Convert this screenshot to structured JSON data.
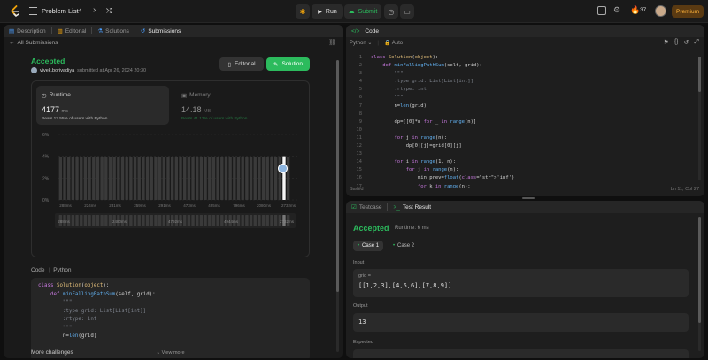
{
  "topbar": {
    "problem_list": "Problem List",
    "run": "Run",
    "submit": "Submit",
    "streak": "37",
    "premium": "Premium"
  },
  "left": {
    "tabs": [
      {
        "label": "Description"
      },
      {
        "label": "Editorial"
      },
      {
        "label": "Solutions"
      },
      {
        "label": "Submissions"
      }
    ],
    "back": "All Submissions",
    "status": "Accepted",
    "user": "vivek.borivadiya",
    "submitted": "submitted at Apr 26, 2024 20:30",
    "editorial_btn": "Editorial",
    "solution_btn": "Solution",
    "runtime": {
      "label": "Runtime",
      "value": "4177",
      "unit": "ms",
      "beats": "Beats 12.55% of users with Python"
    },
    "memory": {
      "label": "Memory",
      "value": "14.18",
      "unit": "MB",
      "beats": "Beats 41.13% of users with Python"
    },
    "code_label": "Code",
    "lang_label": "Python",
    "code_lines": [
      "class Solution(object):",
      "    def minFallingPathSum(self, grid):",
      "        \"\"\"",
      "        :type grid: List[List[int]]",
      "        :rtype: int",
      "        \"\"\"",
      "        n=len(grid)"
    ],
    "view_more": "View more",
    "more_challenges": "More challenges"
  },
  "chart_data": {
    "type": "bar",
    "ylabels": [
      "6%",
      "4%",
      "2%",
      "0%"
    ],
    "ylim": [
      0,
      6
    ],
    "xlabels": [
      "288ms",
      "224ms",
      "231ms",
      "259ms",
      "291ms",
      "473ms",
      "495ms",
      "796ms",
      "2080ms",
      "2732ms"
    ],
    "range_labels": [
      "288ms",
      "2480ms",
      "4792ms",
      "4944ms",
      "2732ms"
    ],
    "values": [
      3.9,
      3.9,
      3.9,
      3.9,
      3.9,
      3.9,
      3.9,
      3.9,
      3.9,
      3.9,
      3.9,
      3.9,
      3.9,
      3.9,
      3.9,
      3.9,
      3.9,
      3.9,
      3.9,
      3.9,
      3.9,
      3.9,
      3.9,
      3.9,
      3.9,
      3.9,
      3.9,
      3.9,
      3.9,
      3.9,
      3.9,
      3.9,
      3.9,
      3.9,
      3.9,
      3.9,
      3.9,
      3.9,
      3.9,
      3.9,
      3.9,
      3.9,
      3.9,
      3.9,
      3.9,
      3.9,
      3.9,
      3.9,
      3.9,
      3.9,
      3.9,
      3.9,
      3.9,
      3.9,
      4.0,
      3.9
    ],
    "highlight_index": 54,
    "bar_color": "#3a3a3a",
    "highlight_color": "#f5f5f5"
  },
  "editor": {
    "title": "Code",
    "language": "Python",
    "mode": "Auto",
    "status": "Saved",
    "position": "Ln 11, Col 27",
    "lines": [
      {
        "n": "1",
        "t": "class Solution(object):"
      },
      {
        "n": "2",
        "t": "    def minFallingPathSum(self, grid):"
      },
      {
        "n": "3",
        "t": "        \"\"\""
      },
      {
        "n": "4",
        "t": "        :type grid: List[List[int]]"
      },
      {
        "n": "5",
        "t": "        :rtype: int"
      },
      {
        "n": "6",
        "t": "        \"\"\""
      },
      {
        "n": "7",
        "t": "        n=len(grid)"
      },
      {
        "n": "8",
        "t": ""
      },
      {
        "n": "9",
        "t": "        dp=[[0]*n for _ in range(n)]"
      },
      {
        "n": "10",
        "t": ""
      },
      {
        "n": "11",
        "t": "        for j in range(n):"
      },
      {
        "n": "12",
        "t": "            dp[0][j]=grid[0][j]"
      },
      {
        "n": "13",
        "t": ""
      },
      {
        "n": "14",
        "t": "        for i in range(1, n):"
      },
      {
        "n": "15",
        "t": "            for j in range(n):"
      },
      {
        "n": "16",
        "t": "                min_prev=float('inf')"
      },
      {
        "n": "17",
        "t": "                for k in range(n):"
      }
    ]
  },
  "result": {
    "tab_testcase": "Testcase",
    "tab_result": "Test Result",
    "status": "Accepted",
    "runtime": "Runtime: 6 ms",
    "case1": "Case 1",
    "case2": "Case 2",
    "input_label": "Input",
    "input_var": "grid =",
    "input_value": "[[1,2,3],[4,5,6],[7,8,9]]",
    "output_label": "Output",
    "output_value": "13",
    "expected_label": "Expected"
  }
}
